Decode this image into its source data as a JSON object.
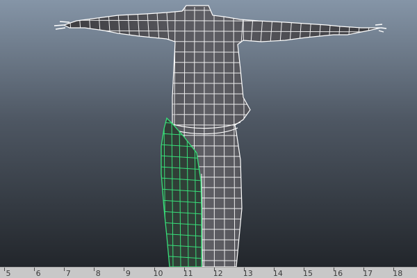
{
  "app": {
    "view": "3d-perspective-viewport",
    "colors": {
      "background_top": "#8595a7",
      "background_bottom": "#22262b",
      "mesh_fill": "#545459",
      "wireframe": "#ffffff",
      "selected_wireframe": "#38e07a",
      "selected_fill": "#303f37",
      "timeline_bg": "#c8c8c8"
    },
    "model": {
      "type": "humanoid-t-pose",
      "display": "wireframe-on-shaded",
      "selected_part": "left-leg"
    }
  },
  "timeline": {
    "frames": [
      "5",
      "6",
      "7",
      "8",
      "9",
      "10",
      "11",
      "12",
      "13",
      "14",
      "15",
      "16",
      "17",
      "18"
    ]
  }
}
